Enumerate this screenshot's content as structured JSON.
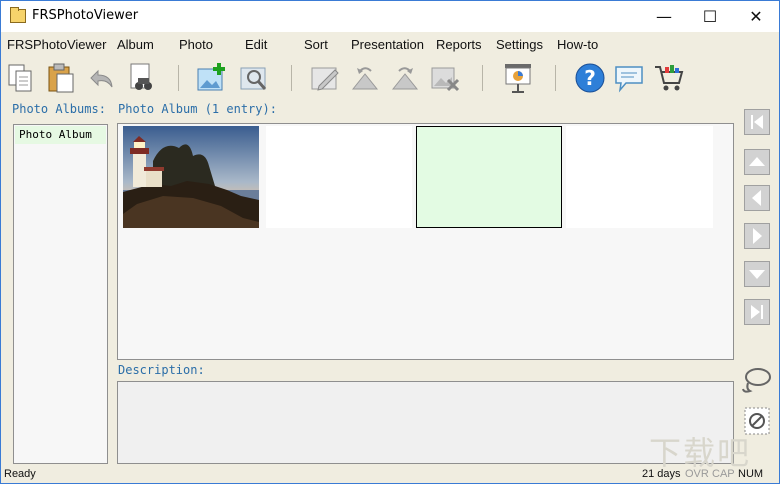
{
  "window": {
    "title": "FRSPhotoViewer"
  },
  "menu": [
    "FRSPhotoViewer",
    "Album",
    "Photo",
    "Edit",
    "Sort",
    "Presentation",
    "Reports",
    "Settings",
    "How-to"
  ],
  "toolbar": {
    "icons": [
      "copy-icon",
      "paste-icon",
      "undo-icon",
      "find-icon",
      "add-photo-icon",
      "view-photo-icon",
      "edit-photo-icon",
      "rotate-left-icon",
      "rotate-right-icon",
      "delete-photo-icon",
      "presentation-icon",
      "help-icon",
      "comment-icon",
      "cart-icon"
    ]
  },
  "albums_panel": {
    "label": "Photo Albums:",
    "items": [
      "Photo Album"
    ]
  },
  "album_panel": {
    "label": "Photo Album (1 entry):"
  },
  "description_panel": {
    "label": "Description:"
  },
  "status": {
    "left": "Ready",
    "days": "21 days",
    "ovr": "OVR",
    "cap": "CAP",
    "num": "NUM"
  },
  "watermark": "下载吧",
  "colors": {
    "accent_label": "#2b6ea8",
    "selection": "#e6f9e3",
    "background": "#f0ede0"
  }
}
